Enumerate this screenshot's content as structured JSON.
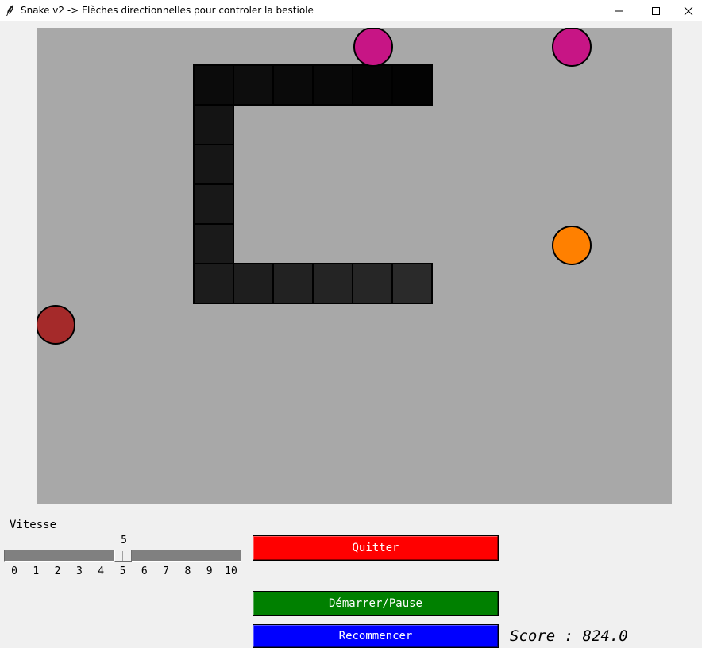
{
  "window": {
    "title": "Snake v2 -> Flèches directionnelles pour controler la bestiole"
  },
  "board": {
    "background": "#a8a8a8",
    "snake_color": "#1c1c1c",
    "snake_cells": 16,
    "fruits": [
      {
        "color": "#c71585"
      },
      {
        "color": "#c71585"
      },
      {
        "color": "#ff8000"
      },
      {
        "color": "#a52a2a"
      }
    ]
  },
  "speed": {
    "label": "Vitesse",
    "value": "5",
    "min": 0,
    "max": 10,
    "ticks": [
      "0",
      "1",
      "2",
      "3",
      "4",
      "5",
      "6",
      "7",
      "8",
      "9",
      "10"
    ]
  },
  "buttons": {
    "quit": {
      "label": "Quitter",
      "color": "#ff0000"
    },
    "start_pause": {
      "label": "Démarrer/Pause",
      "color": "#008000"
    },
    "restart": {
      "label": "Recommencer",
      "color": "#0000ff"
    }
  },
  "score": {
    "text": "Score : 824.0"
  }
}
